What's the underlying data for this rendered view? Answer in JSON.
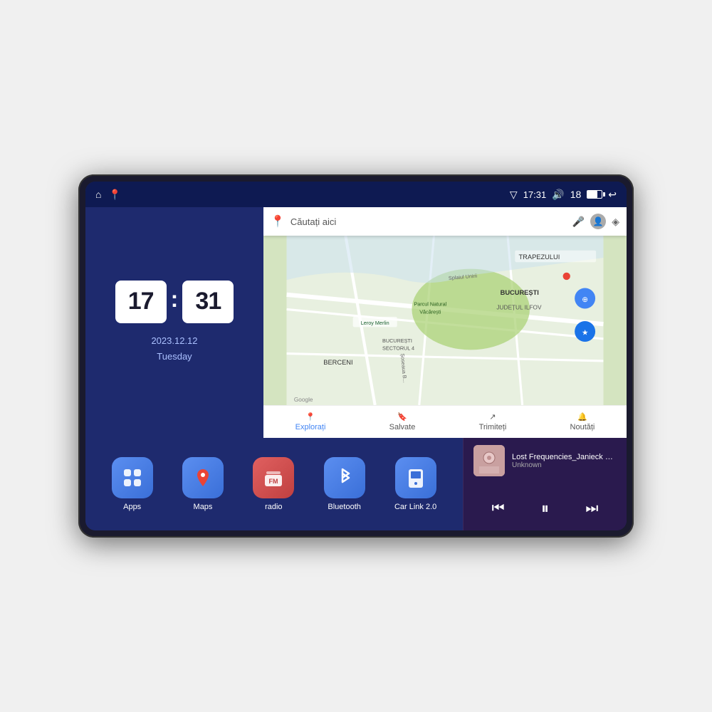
{
  "status_bar": {
    "left_icons": [
      "home",
      "maps"
    ],
    "signal_icon": "▽",
    "time": "17:31",
    "volume_icon": "🔊",
    "volume_level": "18",
    "battery_icon": "battery",
    "back_icon": "↩"
  },
  "clock": {
    "hours": "17",
    "minutes": "31",
    "date": "2023.12.12",
    "day": "Tuesday"
  },
  "map": {
    "search_placeholder": "Căutați aici",
    "location_labels": [
      "TRAPEZULUI",
      "BUCUREȘTI",
      "JUDEȚUL ILFOV",
      "BERCENI",
      "Parcul Natural Văcărești",
      "Leroy Merlin",
      "BUCUREȘTI SECTORUL 4"
    ],
    "bottom_items": [
      {
        "icon": "📍",
        "label": "Explorați"
      },
      {
        "icon": "🔖",
        "label": "Salvate"
      },
      {
        "icon": "↗",
        "label": "Trimiteți"
      },
      {
        "icon": "🔔",
        "label": "Noutăți"
      }
    ]
  },
  "apps": [
    {
      "id": "apps",
      "label": "Apps",
      "icon": "⊞",
      "color_class": "icon-apps"
    },
    {
      "id": "maps",
      "label": "Maps",
      "icon": "📍",
      "color_class": "icon-maps"
    },
    {
      "id": "radio",
      "label": "radio",
      "icon": "📻",
      "color_class": "icon-radio"
    },
    {
      "id": "bluetooth",
      "label": "Bluetooth",
      "icon": "⬡",
      "color_class": "icon-bluetooth"
    },
    {
      "id": "carlink",
      "label": "Car Link 2.0",
      "icon": "📱",
      "color_class": "icon-carlink"
    }
  ],
  "music": {
    "title": "Lost Frequencies_Janieck Devy-...",
    "artist": "Unknown",
    "thumb_emoji": "🎵"
  }
}
